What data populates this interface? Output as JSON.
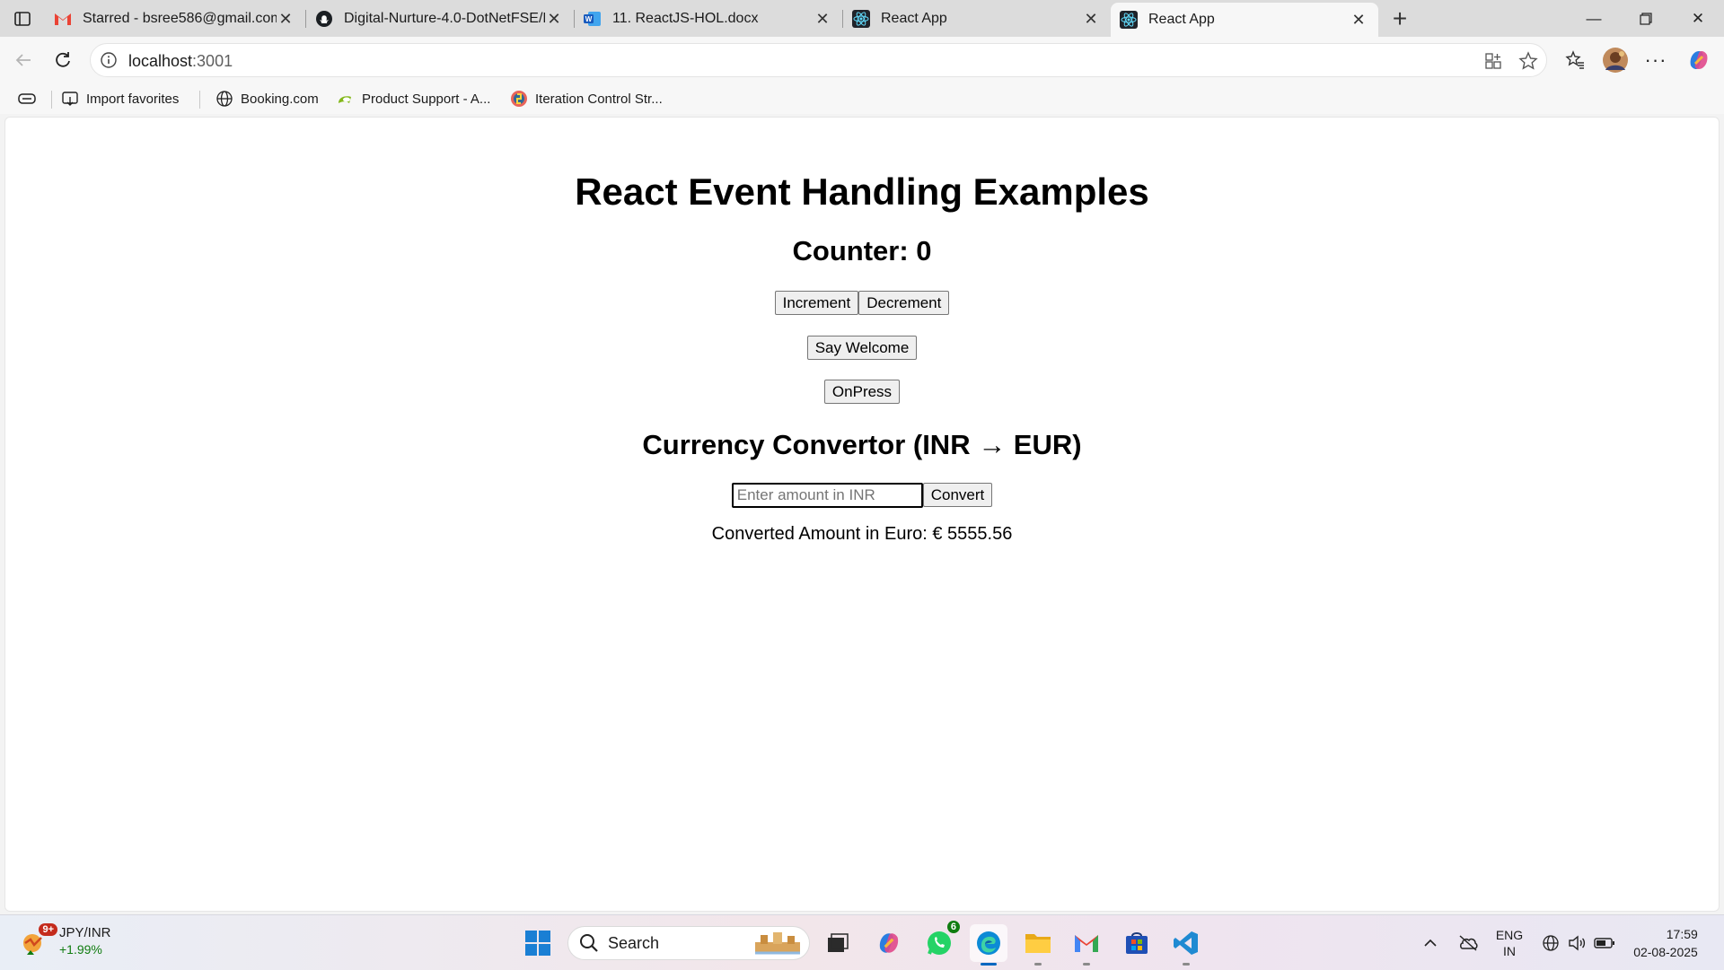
{
  "browser": {
    "tabs": [
      {
        "title": "Starred - bsree586@gmail.com - G",
        "icon": "gmail-icon",
        "active": false
      },
      {
        "title": "Digital-Nurture-4.0-DotNetFSE/D",
        "icon": "github-icon",
        "active": false
      },
      {
        "title": "11. ReactJS-HOL.docx",
        "icon": "word-icon",
        "active": false
      },
      {
        "title": "React App",
        "icon": "react-icon",
        "active": false
      },
      {
        "title": "React App",
        "icon": "react-icon",
        "active": true
      }
    ],
    "address": {
      "host": "localhost",
      "port": ":3001"
    },
    "favorites": [
      {
        "label": "Import favorites",
        "icon": "import-icon"
      },
      {
        "label": "Booking.com",
        "icon": "globe-icon"
      },
      {
        "label": "Product Support - A...",
        "icon": "acer-icon"
      },
      {
        "label": "Iteration Control Str...",
        "icon": "python-icon"
      }
    ]
  },
  "page": {
    "title": "React Event Handling Examples",
    "counter_label": "Counter: 0",
    "buttons": {
      "increment": "Increment",
      "decrement": "Decrement",
      "say_welcome": "Say Welcome",
      "onpress": "OnPress",
      "convert": "Convert"
    },
    "currency_title": "Currency Convertor (INR → EUR)",
    "amount_input": {
      "value": "",
      "placeholder": "Enter amount in INR"
    },
    "converted_text": "Converted Amount in Euro: € 5555.56"
  },
  "taskbar": {
    "widget": {
      "ticker": "JPY/INR",
      "change": "+1.99%",
      "badge": "9+"
    },
    "search_label": "Search",
    "whatsapp_badge": "6",
    "language": {
      "line1": "ENG",
      "line2": "IN"
    },
    "clock": {
      "time": "17:59",
      "date": "02-08-2025"
    }
  },
  "colors": {
    "accent": "#0067c0",
    "react": "#61dafb",
    "positive": "#107c10"
  }
}
